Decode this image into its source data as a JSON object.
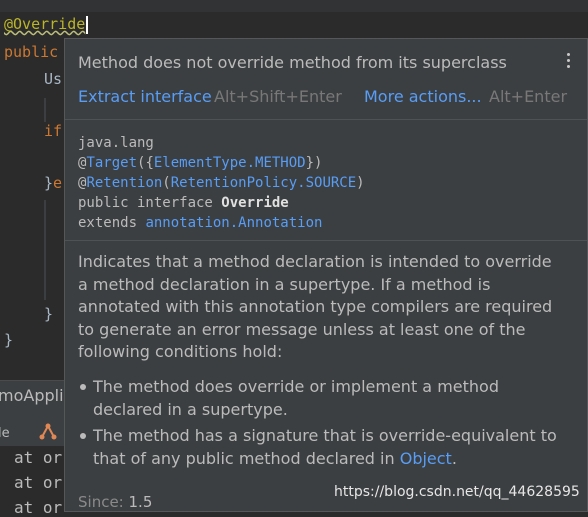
{
  "editor": {
    "line1": "@Override",
    "line2": "public",
    "line3": "Us",
    "line4": "if",
    "line5a": "}",
    "line5b": "e",
    "line6": "}",
    "line7": "}"
  },
  "tool_window": {
    "title_partial": "moAppli",
    "tab_partial": "le"
  },
  "console": {
    "lines": [
      "at or",
      "at or",
      "at or"
    ]
  },
  "popup": {
    "title": "Method does not override method from its superclass",
    "actions": [
      {
        "label": "Extract interface",
        "shortcut": "Alt+Shift+Enter"
      },
      {
        "label": "More actions...",
        "shortcut": "Alt+Enter"
      }
    ],
    "declaration": {
      "package": "java.lang",
      "at1": "@",
      "target": "Target",
      "target_open": "({",
      "element_type": "ElementType.METHOD",
      "target_close": "})",
      "at2": "@",
      "retention": "Retention",
      "ret_open": "(",
      "retention_policy": "RetentionPolicy.SOURCE",
      "ret_close": ")",
      "interface_prefix": "public interface ",
      "interface_name": "Override",
      "extends_prefix": "extends ",
      "extends_type": "annotation.Annotation"
    },
    "description": "Indicates that a method declaration is intended to override a method declaration in a supertype. If a method is annotated with this annotation type compilers are required to generate an error message unless at least one of the following conditions hold:",
    "bullets": [
      {
        "text": "The method does override or implement a method declared in a supertype."
      },
      {
        "text_before": "The method has a signature that is override-equivalent to that of any public method declared in ",
        "link": "Object",
        "text_after": "."
      }
    ],
    "since_label": "Since:",
    "since_value": "1.5"
  },
  "watermark": "https://blog.csdn.net/qq_44628595",
  "colors": {
    "link": "#589df6",
    "annotation": "#bbb529",
    "keyword": "#cc7832",
    "popup_bg": "#3c3f41",
    "editor_bg": "#2b2b2b"
  }
}
